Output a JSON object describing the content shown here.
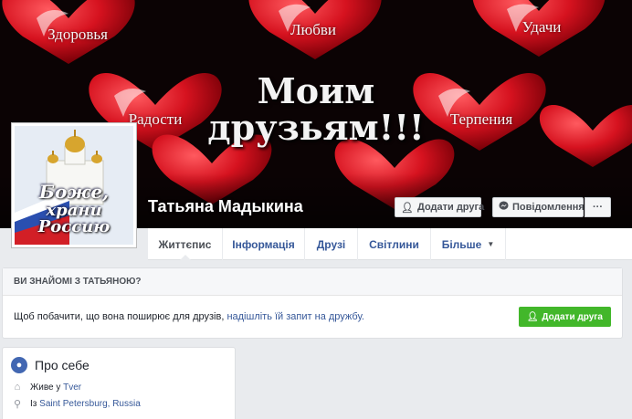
{
  "cover": {
    "hearts": [
      {
        "label": "Здоровья"
      },
      {
        "label": "Любви"
      },
      {
        "label": "Удачи"
      },
      {
        "label": "Радости"
      },
      {
        "label": "Терпения"
      }
    ],
    "line1": "Моим",
    "line2": "друзьям!!!"
  },
  "profile": {
    "pic_text1": "Боже,",
    "pic_text2": "храни Россию",
    "name": "Татьяна Мадыкина",
    "add_friend": "Додати друга",
    "message": "Повідомлення",
    "more": "···"
  },
  "nav": {
    "items": [
      {
        "label": "Життєпис"
      },
      {
        "label": "Інформація"
      },
      {
        "label": "Друзі"
      },
      {
        "label": "Світлини"
      },
      {
        "label": "Більше"
      }
    ]
  },
  "friend_box": {
    "title": "ВИ ЗНАЙОМІ З ТАТЬЯНОЮ?",
    "text": "Щоб побачити, що вона поширює для друзів, ",
    "link": "надішліть їй запит на дружбу.",
    "button": "Додати друга"
  },
  "about": {
    "title": "Про себе",
    "lives_prefix": "Живе у ",
    "lives_city": "Tver",
    "from_prefix": "Із ",
    "from_city": "Saint Petersburg, Russia"
  },
  "colors": {
    "accent": "#365899",
    "brand": "#4267b2",
    "green": "#42b72a",
    "heart": "#d6121f"
  },
  "icons": [
    "add-friend-icon",
    "messenger-icon",
    "caret-down-icon",
    "globe-icon",
    "home-icon",
    "location-pin-icon"
  ]
}
